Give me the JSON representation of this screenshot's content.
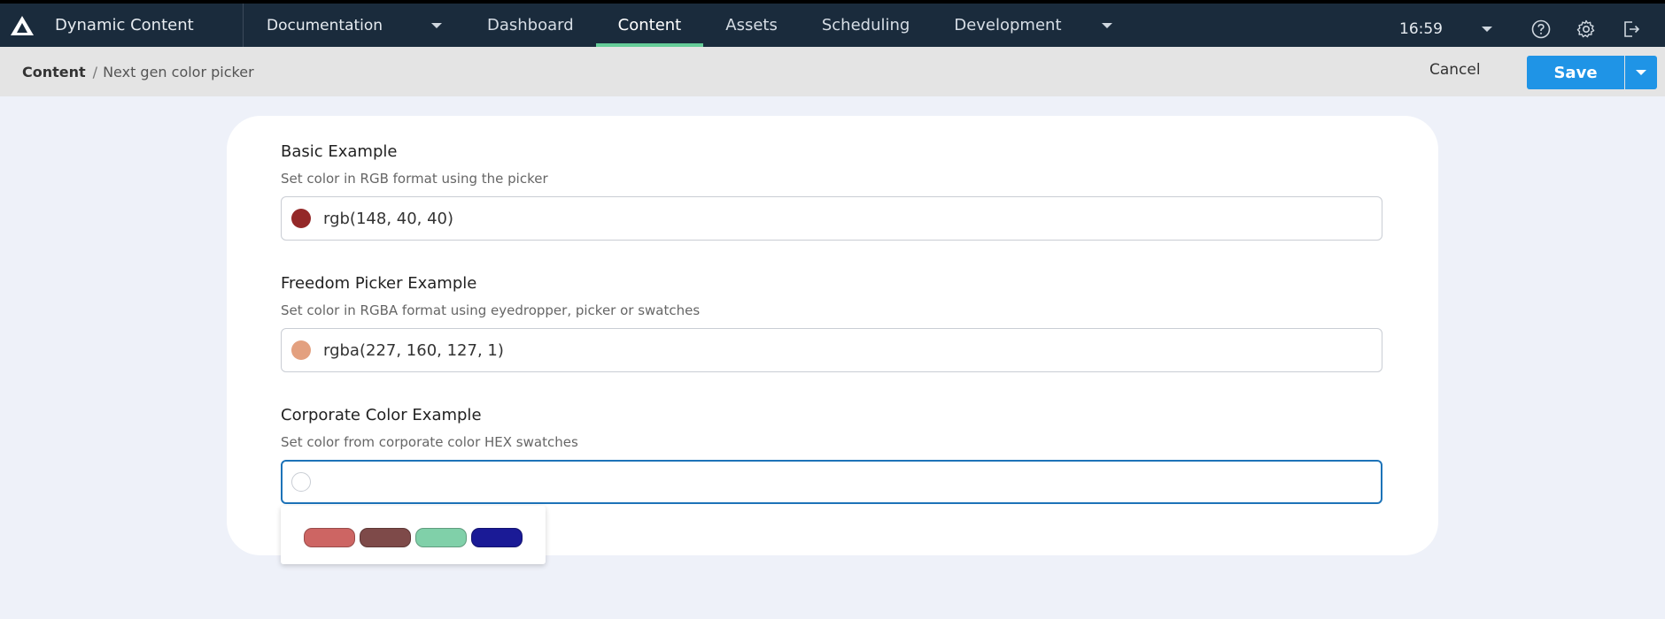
{
  "app": {
    "name": "Dynamic Content"
  },
  "hub": {
    "label": "Documentation"
  },
  "nav": {
    "tabs": [
      "Dashboard",
      "Content",
      "Assets",
      "Scheduling",
      "Development"
    ],
    "active": "Content",
    "time": "16:59"
  },
  "icons": {
    "logo": "amplience-logo-icon",
    "help": "help-circle-icon",
    "settings": "gear-icon",
    "logout": "logout-icon",
    "caret": "chevron-down-icon"
  },
  "breadcrumb": {
    "root": "Content",
    "separator": "/",
    "current": "Next gen color picker"
  },
  "actions": {
    "cancel": "Cancel",
    "save": "Save"
  },
  "fields": [
    {
      "title": "Basic Example",
      "description": "Set color in RGB format using the picker",
      "value": "rgb(148, 40, 40)",
      "swatch": "#942828"
    },
    {
      "title": "Freedom Picker Example",
      "description": "Set color in RGBA format using eyedropper, picker or swatches",
      "value": "rgba(227, 160, 127, 1)",
      "swatch": "#e3a07f"
    },
    {
      "title": "Corporate Color Example",
      "description": "Set color from corporate color HEX swatches",
      "value": "",
      "swatch": "#ffffff"
    }
  ],
  "swatches": [
    "#cd6563",
    "#7e4a49",
    "#80d0a9",
    "#1a1a96"
  ],
  "colors": {
    "topbar": "#1a2b3c",
    "accent": "#65cc98",
    "primary": "#1f94e6",
    "focus": "#1d73b8"
  }
}
